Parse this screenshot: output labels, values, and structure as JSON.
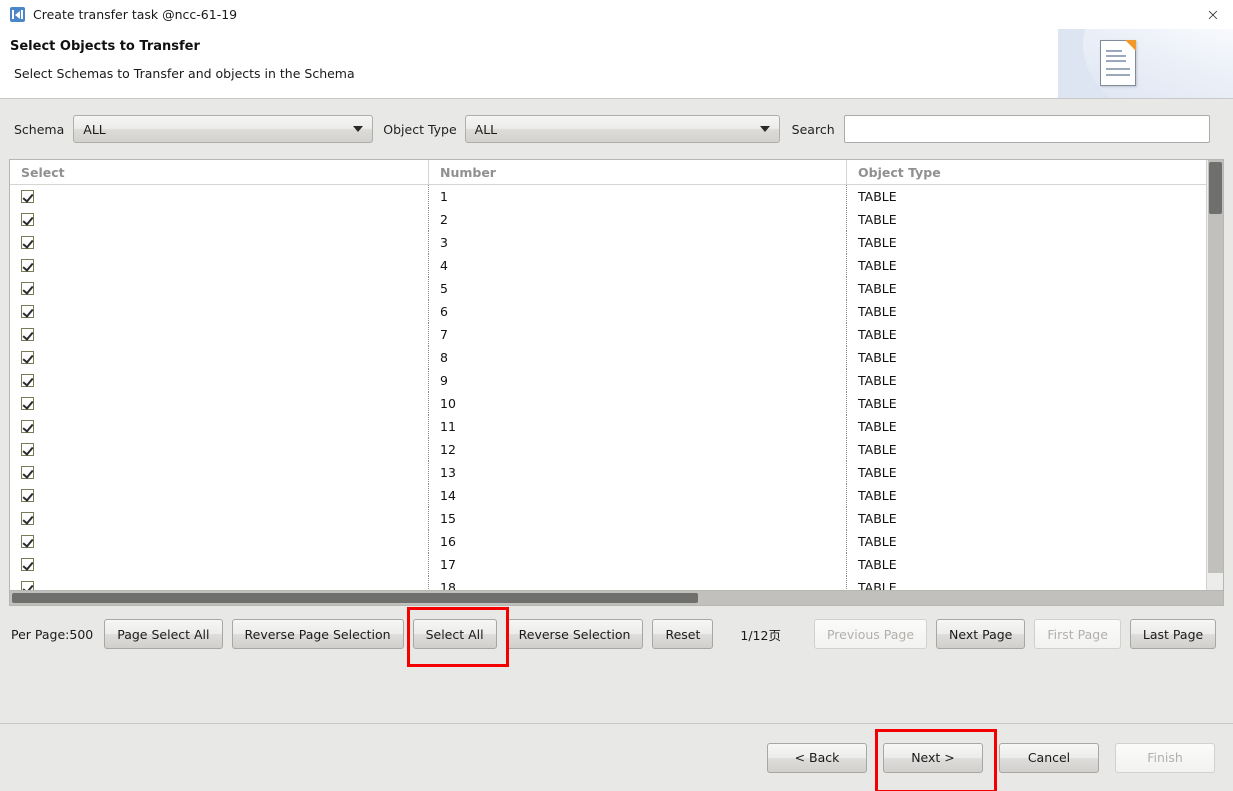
{
  "window": {
    "title": "Create transfer task @ncc-61-19",
    "icon": "transfer-icon",
    "close_icon": "×"
  },
  "header": {
    "title": "Select Objects to Transfer",
    "subtitle": "Select Schemas to Transfer and objects in the Schema",
    "art_icon": "document-icon"
  },
  "filters": {
    "schema_label": "Schema",
    "schema_value": "ALL",
    "object_type_label": "Object Type",
    "object_type_value": "ALL",
    "search_label": "Search",
    "search_value": "",
    "search_placeholder": ""
  },
  "table": {
    "columns": [
      "Select",
      "Number",
      "Object Type"
    ],
    "rows": [
      {
        "selected": true,
        "number": "1",
        "object_type": "TABLE"
      },
      {
        "selected": true,
        "number": "2",
        "object_type": "TABLE"
      },
      {
        "selected": true,
        "number": "3",
        "object_type": "TABLE"
      },
      {
        "selected": true,
        "number": "4",
        "object_type": "TABLE"
      },
      {
        "selected": true,
        "number": "5",
        "object_type": "TABLE"
      },
      {
        "selected": true,
        "number": "6",
        "object_type": "TABLE"
      },
      {
        "selected": true,
        "number": "7",
        "object_type": "TABLE"
      },
      {
        "selected": true,
        "number": "8",
        "object_type": "TABLE"
      },
      {
        "selected": true,
        "number": "9",
        "object_type": "TABLE"
      },
      {
        "selected": true,
        "number": "10",
        "object_type": "TABLE"
      },
      {
        "selected": true,
        "number": "11",
        "object_type": "TABLE"
      },
      {
        "selected": true,
        "number": "12",
        "object_type": "TABLE"
      },
      {
        "selected": true,
        "number": "13",
        "object_type": "TABLE"
      },
      {
        "selected": true,
        "number": "14",
        "object_type": "TABLE"
      },
      {
        "selected": true,
        "number": "15",
        "object_type": "TABLE"
      },
      {
        "selected": true,
        "number": "16",
        "object_type": "TABLE"
      },
      {
        "selected": true,
        "number": "17",
        "object_type": "TABLE"
      },
      {
        "selected": true,
        "number": "18",
        "object_type": "TABLE"
      }
    ]
  },
  "pager": {
    "per_page": "Per Page:500",
    "page_select_all": "Page Select All",
    "reverse_page_selection": "Reverse Page Selection",
    "select_all": "Select All",
    "reverse_selection": "Reverse Selection",
    "reset": "Reset",
    "page_info": "1/12页",
    "previous_page": "Previous Page",
    "next_page": "Next Page",
    "first_page": "First Page",
    "last_page": "Last Page"
  },
  "footer": {
    "back": "< Back",
    "next": "Next >",
    "cancel": "Cancel",
    "finish": "Finish"
  },
  "colors": {
    "highlight": "#f40000",
    "accent": "#4a86c8",
    "panel": "#e8e8e6"
  }
}
